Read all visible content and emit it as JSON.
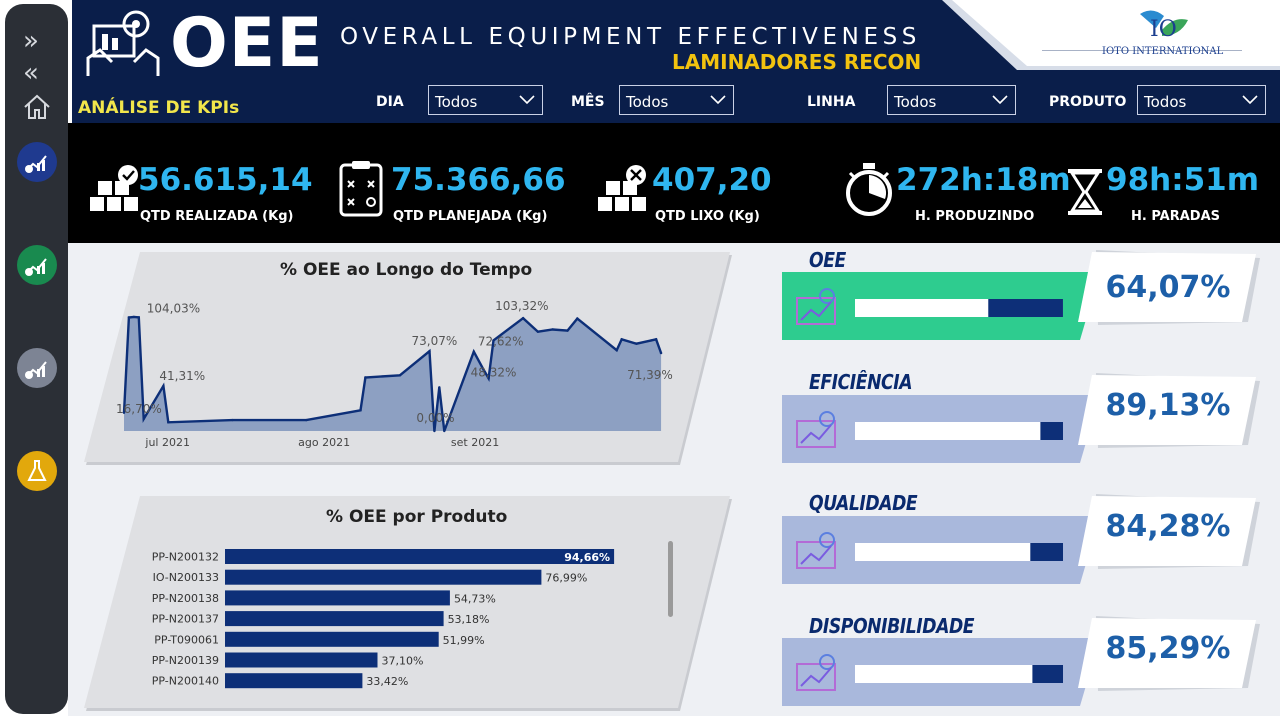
{
  "header": {
    "oee": "OEE",
    "title": "OVERALL EQUIPMENT EFFECTIVENESS",
    "subtitle": "LAMINADORES RECON",
    "section": "ANÁLISE DE KPIs",
    "logo_text": "IOTO INTERNATIONAL"
  },
  "filters": [
    {
      "label": "DIA",
      "value": "Todos"
    },
    {
      "label": "MÊS",
      "value": "Todos"
    },
    {
      "label": "LINHA",
      "value": "Todos"
    },
    {
      "label": "PRODUTO",
      "value": "Todos"
    }
  ],
  "kpis": [
    {
      "value": "56.615,14",
      "caption": "QTD REALIZADA (Kg)",
      "icon": "boxes-check-icon"
    },
    {
      "value": "75.366,66",
      "caption": "QTD PLANEJADA (Kg)",
      "icon": "clipboard-plan-icon"
    },
    {
      "value": "407,20",
      "caption": "QTD LIXO (Kg)",
      "icon": "boxes-x-icon"
    },
    {
      "value": "272h:18m",
      "caption": "H. PRODUZINDO",
      "icon": "stopwatch-icon"
    },
    {
      "value": "98h:51m",
      "caption": "H. PARADAS",
      "icon": "hourglass-icon"
    }
  ],
  "metrics": [
    {
      "title": "OEE",
      "value": "64,07%",
      "fraction": 0.6407,
      "color": "#2ecc8f"
    },
    {
      "title": "EFICIÊNCIA",
      "value": "89,13%",
      "fraction": 0.8913,
      "color": "#a9b8dc"
    },
    {
      "title": "QUALIDADE",
      "value": "84,28%",
      "fraction": 0.8428,
      "color": "#a9b8dc"
    },
    {
      "title": "DISPONIBILIDADE",
      "value": "85,29%",
      "fraction": 0.8529,
      "color": "#a9b8dc"
    }
  ],
  "colors": {
    "accent": "#2fb6f0",
    "navy": "#0a1e4a",
    "bar": "#0d2f78",
    "yellow": "#f2c30f"
  },
  "chart_data": [
    {
      "type": "area",
      "title": "% OEE ao Longo do Tempo",
      "x_ticks": [
        "jul 2021",
        "ago 2021",
        "set 2021"
      ],
      "ylim": [
        0,
        120
      ],
      "points": [
        {
          "x": "2021-06-23",
          "y": 16.7
        },
        {
          "x": "2021-06-24",
          "y": 104.0
        },
        {
          "x": "2021-06-25",
          "y": 104.5
        },
        {
          "x": "2021-06-26",
          "y": 104.03
        },
        {
          "x": "2021-06-27",
          "y": 11.0
        },
        {
          "x": "2021-07-01",
          "y": 41.31
        },
        {
          "x": "2021-07-02",
          "y": 8.0
        },
        {
          "x": "2021-07-15",
          "y": 10.0
        },
        {
          "x": "2021-07-30",
          "y": 10.0
        },
        {
          "x": "2021-08-10",
          "y": 19.0
        },
        {
          "x": "2021-08-11",
          "y": 49.0
        },
        {
          "x": "2021-08-18",
          "y": 51.0
        },
        {
          "x": "2021-08-24",
          "y": 73.07
        },
        {
          "x": "2021-08-25",
          "y": 0.0
        },
        {
          "x": "2021-08-26",
          "y": 40.0
        },
        {
          "x": "2021-08-27",
          "y": 0.0
        },
        {
          "x": "2021-09-02",
          "y": 72.62
        },
        {
          "x": "2021-09-04",
          "y": 56.0
        },
        {
          "x": "2021-09-05",
          "y": 48.32
        },
        {
          "x": "2021-09-06",
          "y": 83.0
        },
        {
          "x": "2021-09-12",
          "y": 103.32
        },
        {
          "x": "2021-09-15",
          "y": 91.0
        },
        {
          "x": "2021-09-18",
          "y": 93.0
        },
        {
          "x": "2021-09-21",
          "y": 92.0
        },
        {
          "x": "2021-09-23",
          "y": 103.0
        },
        {
          "x": "2021-10-01",
          "y": 74.0
        },
        {
          "x": "2021-10-02",
          "y": 84.0
        },
        {
          "x": "2021-10-05",
          "y": 80.0
        },
        {
          "x": "2021-10-08",
          "y": 83.0
        },
        {
          "x": "2021-10-09",
          "y": 84.0
        },
        {
          "x": "2021-10-10",
          "y": 71.39
        }
      ],
      "labels": [
        {
          "x": "2021-06-23",
          "y": 16.7,
          "text": "16,70%"
        },
        {
          "x": "2021-06-26",
          "y": 104.03,
          "text": "104,03%"
        },
        {
          "x": "2021-07-01",
          "y": 41.31,
          "text": "41,31%"
        },
        {
          "x": "2021-08-24",
          "y": 73.07,
          "text": "73,07%"
        },
        {
          "x": "2021-08-25",
          "y": 0.0,
          "text": "0,00%"
        },
        {
          "x": "2021-09-02",
          "y": 72.62,
          "text": "72,62%"
        },
        {
          "x": "2021-09-05",
          "y": 48.32,
          "text": "48,32%"
        },
        {
          "x": "2021-09-12",
          "y": 103.32,
          "text": "103,32%"
        },
        {
          "x": "2021-10-10",
          "y": 71.39,
          "text": "71,39%"
        }
      ]
    },
    {
      "type": "bar",
      "title": "% OEE por Produto",
      "categories": [
        "PP-N200132",
        "IO-N200133",
        "PP-N200138",
        "PP-N200137",
        "PP-T090061",
        "PP-N200139",
        "PP-N200140"
      ],
      "values": [
        94.66,
        76.99,
        54.73,
        53.18,
        51.99,
        37.1,
        33.42
      ],
      "value_labels": [
        "94,66%",
        "76,99%",
        "54,73%",
        "53,18%",
        "51,99%",
        "37,10%",
        "33,42%"
      ],
      "xlim": [
        0,
        100
      ]
    }
  ]
}
